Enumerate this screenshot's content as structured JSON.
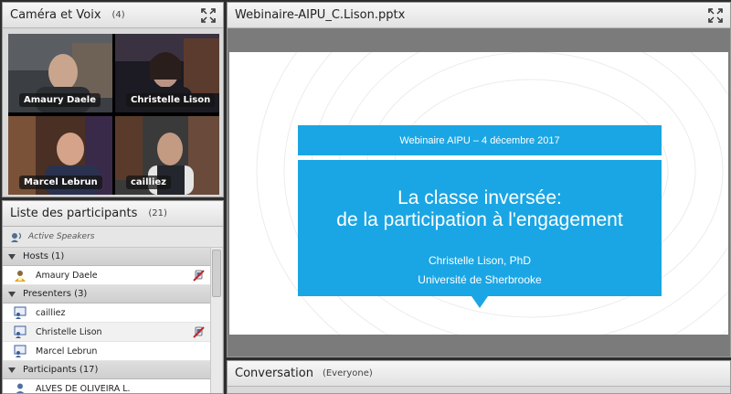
{
  "camera": {
    "title": "Caméra et Voix",
    "count": "(4)",
    "tiles": [
      {
        "name": "Amaury Daele"
      },
      {
        "name": "Christelle Lison"
      },
      {
        "name": "Marcel Lebrun"
      },
      {
        "name": "cailliez"
      }
    ]
  },
  "participants": {
    "title": "Liste des participants",
    "count": "(21)",
    "active_speakers": "Active Speakers",
    "groups": [
      {
        "label": "Hosts (1)"
      },
      {
        "label": "Presenters (3)"
      },
      {
        "label": "Participants (17)"
      }
    ],
    "hosts": [
      "Amaury Daele"
    ],
    "presenters": [
      "cailliez",
      "Christelle Lison",
      "Marcel Lebrun"
    ],
    "attendees": [
      "ALVES DE OLIVEIRA L."
    ]
  },
  "share": {
    "title": "Webinaire-AIPU_C.Lison.pptx",
    "slide": {
      "banner": "Webinaire AIPU – 4 décembre 2017",
      "title_line1": "La classe inversée:",
      "title_line2": "de la participation à l'engagement",
      "author": "Christelle Lison, PhD",
      "affiliation": "Université de Sherbrooke"
    }
  },
  "conversation": {
    "title": "Conversation",
    "scope": "(Everyone)"
  },
  "colors": {
    "accent": "#1aa6e4",
    "mic_off": "#c0262d"
  },
  "icons": [
    "expand-icon",
    "speaker-icon",
    "host-icon",
    "presenter-icon",
    "mic-off-icon",
    "participant-icon"
  ]
}
